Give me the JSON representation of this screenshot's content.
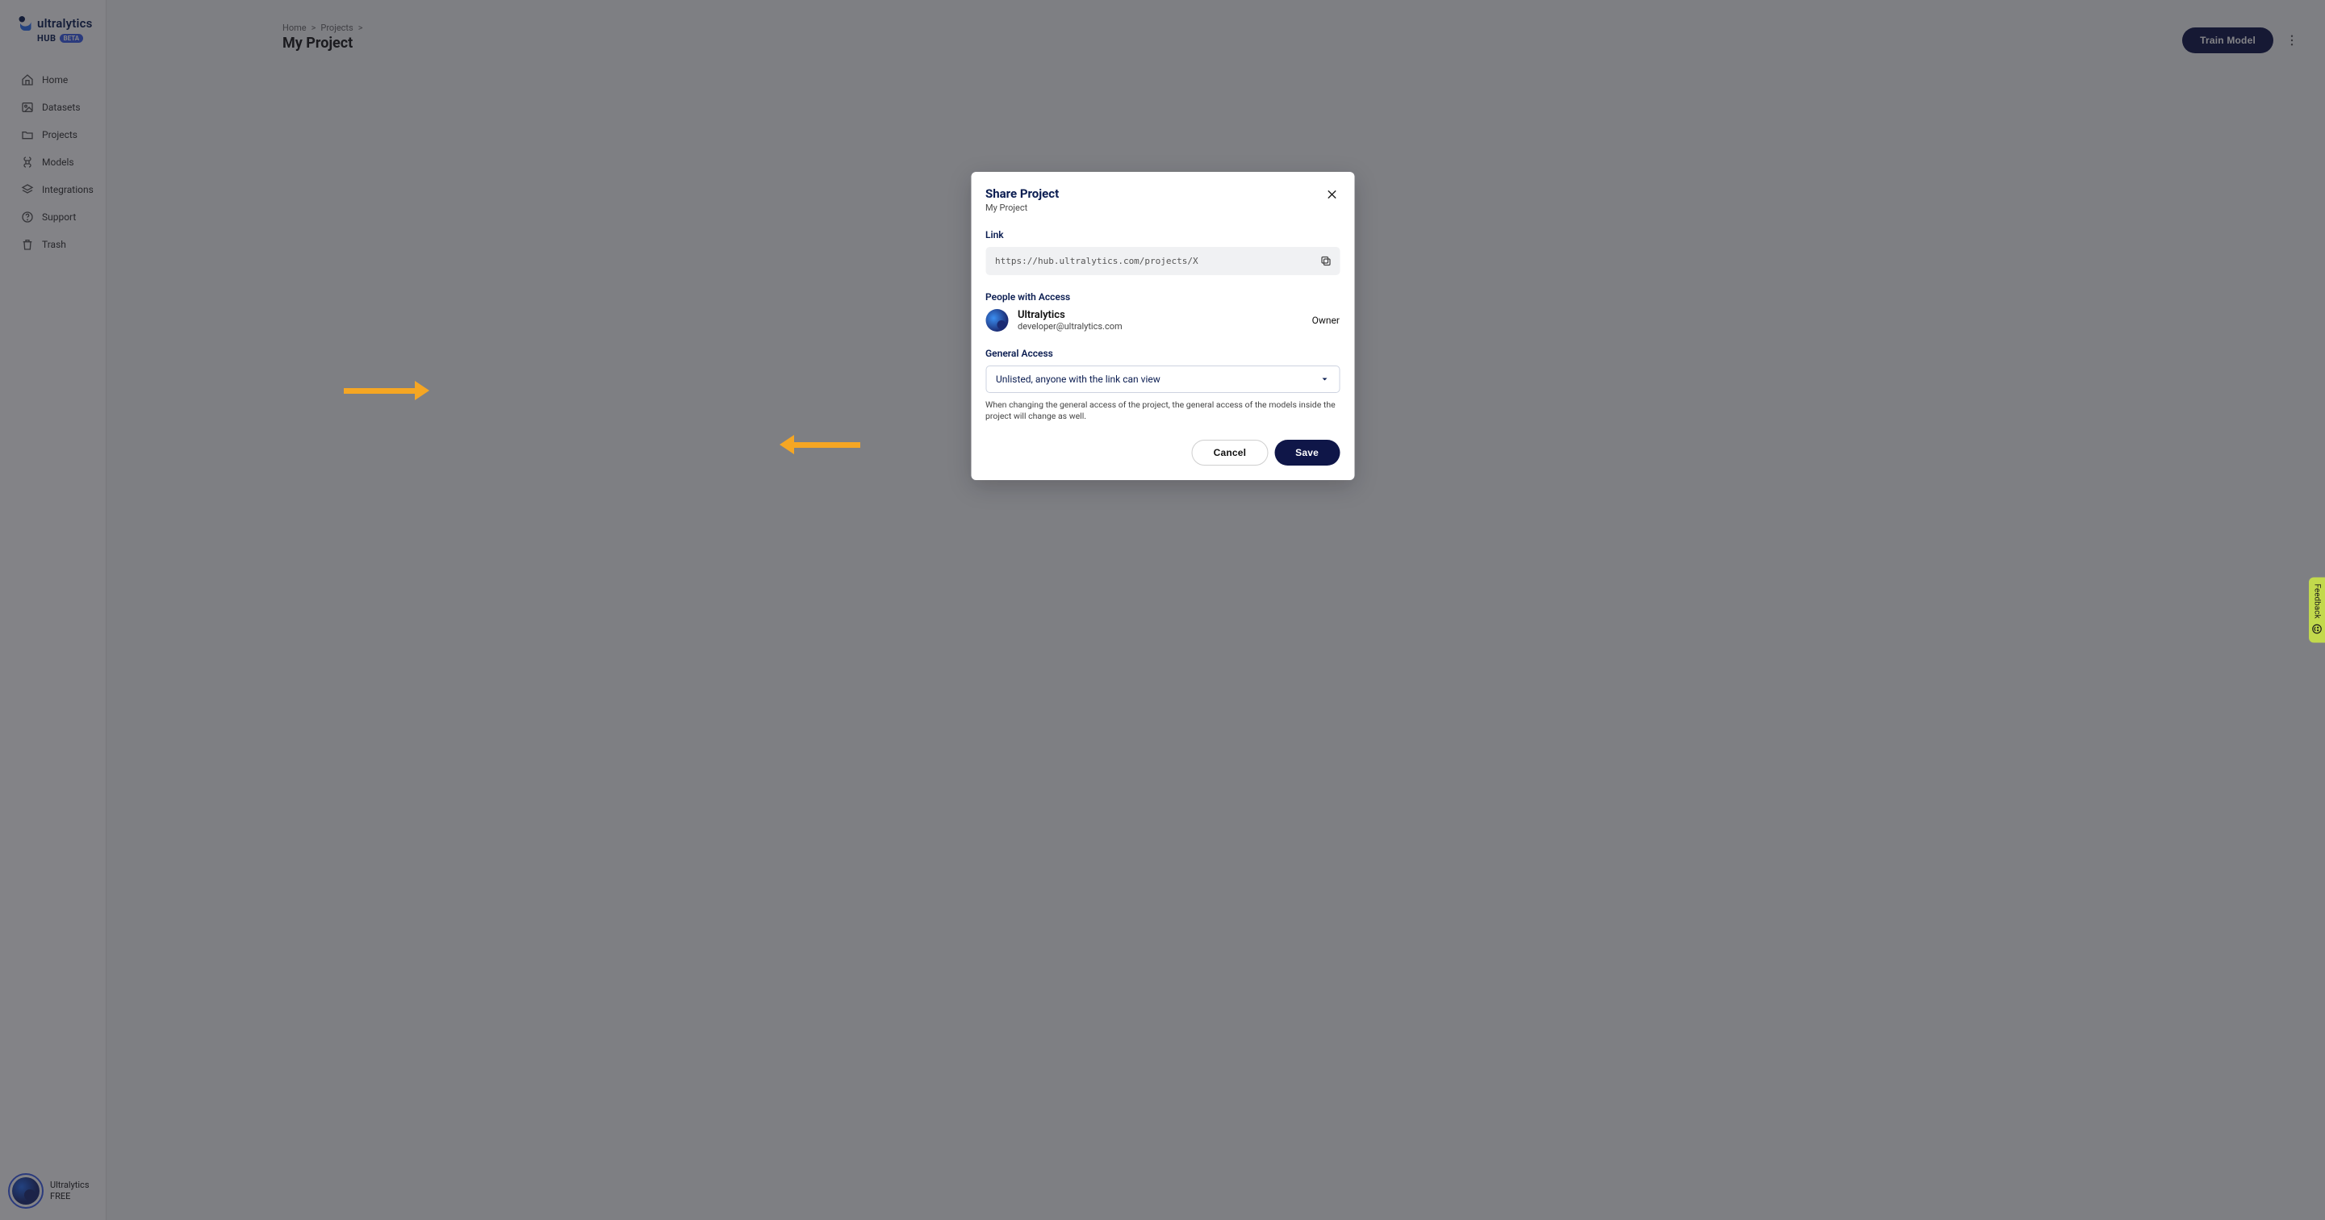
{
  "brand": {
    "name": "ultralytics",
    "hub": "HUB",
    "beta": "BETA"
  },
  "sidebar": {
    "items": [
      {
        "label": "Home"
      },
      {
        "label": "Datasets"
      },
      {
        "label": "Projects"
      },
      {
        "label": "Models"
      },
      {
        "label": "Integrations"
      },
      {
        "label": "Support"
      },
      {
        "label": "Trash"
      }
    ],
    "footer": {
      "name": "Ultralytics",
      "plan": "FREE"
    }
  },
  "breadcrumb": {
    "home": "Home",
    "sep": ">",
    "projects": "Projects"
  },
  "page": {
    "title": "My Project"
  },
  "buttons": {
    "train": "Train Model",
    "cancel": "Cancel",
    "save": "Save"
  },
  "modal": {
    "title": "Share Project",
    "subtitle": "My Project",
    "link_label": "Link",
    "link_value": "https://hub.ultralytics.com/projects/X",
    "people_label": "People with Access",
    "person": {
      "name": "Ultralytics",
      "email": "developer@ultralytics.com",
      "role": "Owner"
    },
    "general_label": "General Access",
    "dropdown_value": "Unlisted, anyone with the link can view",
    "helper": "When changing the general access of the project, the general access of the models inside the project will change as well."
  },
  "feedback": {
    "label": "Feedback"
  }
}
